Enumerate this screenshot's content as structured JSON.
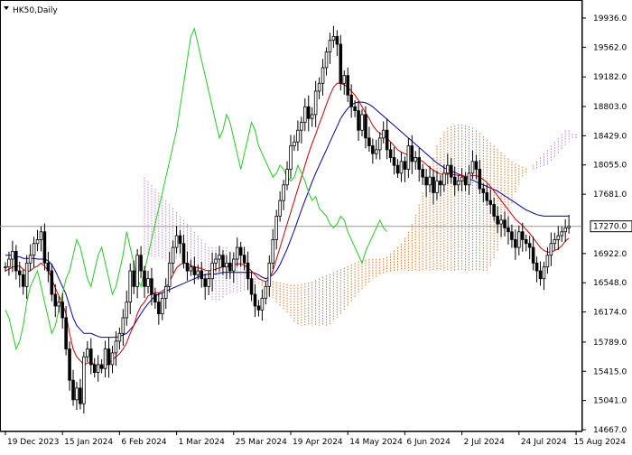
{
  "chart_data": {
    "type": "candlestick",
    "symbol_label": "HK50,Daily",
    "last_price_label": "17270.0",
    "colors": {
      "background": "#ffffff",
      "candle": "#000000",
      "tenkan": "#cc0000",
      "kijun": "#0000aa",
      "chikou": "#22cc22",
      "cloud_bull": "#e07020",
      "cloud_bear": "#c080d0",
      "price_line": "#999999"
    },
    "y_axis": {
      "ylim": [
        14667.0,
        20120.0
      ],
      "ticks": [
        {
          "value": 14667.0,
          "label": "14667.0"
        },
        {
          "value": 15041.0,
          "label": "15041.0"
        },
        {
          "value": 15415.0,
          "label": "15415.0"
        },
        {
          "value": 15789.0,
          "label": "15789.0"
        },
        {
          "value": 16174.0,
          "label": "16174.0"
        },
        {
          "value": 16548.0,
          "label": "16548.0"
        },
        {
          "value": 16922.0,
          "label": "16922.0"
        },
        {
          "value": 17681.0,
          "label": "17681.0"
        },
        {
          "value": 18055.0,
          "label": "18055.0"
        },
        {
          "value": 18429.0,
          "label": "18429.0"
        },
        {
          "value": 18803.0,
          "label": "18803.0"
        },
        {
          "value": 19182.0,
          "label": "19182.0"
        },
        {
          "value": 19562.0,
          "label": "19562.0"
        },
        {
          "value": 19936.0,
          "label": "19936.0"
        }
      ]
    },
    "x_axis": {
      "ticks": [
        {
          "index": 0,
          "label": "19 Dec 2023"
        },
        {
          "index": 16,
          "label": "15 Jan 2024"
        },
        {
          "index": 32,
          "label": "6 Feb 2024"
        },
        {
          "index": 48,
          "label": "1 Mar 2024"
        },
        {
          "index": 64,
          "label": "25 Mar 2024"
        },
        {
          "index": 80,
          "label": "19 Apr 2024"
        },
        {
          "index": 96,
          "label": "14 May 2024"
        },
        {
          "index": 112,
          "label": "6 Jun 2024"
        },
        {
          "index": 128,
          "label": "2 Jul 2024"
        },
        {
          "index": 144,
          "label": "24 Jul 2024"
        },
        {
          "index": 160,
          "label": "15 Aug 2024"
        }
      ]
    },
    "price_close": [
      16750,
      16850,
      16950,
      16700,
      16650,
      16500,
      16800,
      16900,
      17050,
      17100,
      17200,
      16800,
      16700,
      16400,
      16250,
      16300,
      16100,
      15700,
      15300,
      15050,
      15200,
      15000,
      15600,
      15700,
      15500,
      15400,
      15500,
      15450,
      15700,
      15500,
      15650,
      15800,
      15900,
      16100,
      16300,
      16700,
      16500,
      16900,
      16700,
      16500,
      16600,
      16400,
      16300,
      16150,
      16350,
      16500,
      16800,
      17000,
      17150,
      17050,
      16800,
      16700,
      16750,
      16650,
      16700,
      16600,
      16500,
      16600,
      16800,
      16850,
      16900,
      16750,
      16800,
      16700,
      16850,
      17000,
      16900,
      16800,
      16600,
      16400,
      16250,
      16200,
      16350,
      16500,
      16800,
      17100,
      17400,
      17600,
      17800,
      18000,
      18300,
      18350,
      18500,
      18600,
      18800,
      18650,
      18700,
      19000,
      19100,
      19300,
      19500,
      19650,
      19700,
      19600,
      19100,
      19200,
      18950,
      18800,
      18750,
      18500,
      18700,
      18400,
      18300,
      18200,
      18250,
      18400,
      18500,
      18250,
      18150,
      18050,
      17950,
      18100,
      18000,
      18300,
      18100,
      18150,
      18000,
      17900,
      17800,
      17900,
      17700,
      17850,
      17800,
      17950,
      18050,
      17900,
      17800,
      17850,
      17900,
      17800,
      17950,
      18100,
      18000,
      17750,
      17700,
      17600,
      17550,
      17400,
      17300,
      17350,
      17250,
      17200,
      17100,
      17000,
      17200,
      17100,
      17050,
      17000,
      16800,
      16700,
      16600,
      16750,
      16900,
      17050,
      17100,
      17150,
      17200,
      17250,
      17270
    ],
    "tenkan": [
      16700,
      16720,
      16750,
      16760,
      16760,
      16720,
      16690,
      16700,
      16740,
      16760,
      16800,
      16760,
      16700,
      16600,
      16480,
      16380,
      16280,
      16150,
      15900,
      15700,
      15600,
      15550,
      15500,
      15520,
      15530,
      15500,
      15480,
      15450,
      15480,
      15520,
      15560,
      15600,
      15640,
      15700,
      15780,
      15900,
      16000,
      16150,
      16250,
      16300,
      16380,
      16400,
      16420,
      16420,
      16440,
      16480,
      16560,
      16650,
      16740,
      16780,
      16800,
      16790,
      16770,
      16750,
      16740,
      16730,
      16710,
      16700,
      16710,
      16720,
      16740,
      16750,
      16760,
      16760,
      16780,
      16790,
      16790,
      16770,
      16740,
      16700,
      16650,
      16600,
      16580,
      16560,
      16600,
      16700,
      16850,
      17000,
      17150,
      17300,
      17450,
      17600,
      17750,
      17900,
      18050,
      18200,
      18330,
      18450,
      18580,
      18700,
      18830,
      18950,
      19050,
      19100,
      19100,
      19080,
      19050,
      19000,
      18950,
      18880,
      18800,
      18720,
      18650,
      18560,
      18500,
      18460,
      18440,
      18400,
      18350,
      18300,
      18250,
      18220,
      18200,
      18180,
      18160,
      18140,
      18120,
      18100,
      18060,
      18020,
      17990,
      17960,
      17940,
      17930,
      17940,
      17940,
      17930,
      17920,
      17920,
      17910,
      17910,
      17920,
      17920,
      17900,
      17870,
      17830,
      17780,
      17720,
      17660,
      17600,
      17540,
      17480,
      17420,
      17360,
      17320,
      17280,
      17230,
      17180,
      17120,
      17060,
      17000,
      16960,
      16940,
      16940,
      16960,
      16980,
      17020,
      17080,
      17120
    ],
    "kijun": [
      16900,
      16900,
      16900,
      16880,
      16880,
      16860,
      16860,
      16860,
      16860,
      16850,
      16850,
      16850,
      16830,
      16780,
      16700,
      16600,
      16500,
      16400,
      16250,
      16100,
      16000,
      15950,
      15900,
      15900,
      15900,
      15880,
      15860,
      15850,
      15850,
      15850,
      15850,
      15850,
      15860,
      15880,
      15900,
      15950,
      16000,
      16080,
      16150,
      16220,
      16280,
      16330,
      16380,
      16400,
      16420,
      16440,
      16460,
      16480,
      16500,
      16520,
      16540,
      16560,
      16580,
      16600,
      16620,
      16640,
      16650,
      16660,
      16660,
      16660,
      16670,
      16680,
      16680,
      16680,
      16680,
      16680,
      16680,
      16680,
      16680,
      16680,
      16670,
      16650,
      16620,
      16600,
      16620,
      16650,
      16700,
      16780,
      16880,
      16980,
      17100,
      17220,
      17350,
      17480,
      17600,
      17720,
      17840,
      17950,
      18050,
      18150,
      18250,
      18350,
      18450,
      18550,
      18650,
      18720,
      18780,
      18820,
      18850,
      18860,
      18860,
      18850,
      18830,
      18800,
      18760,
      18720,
      18680,
      18640,
      18600,
      18560,
      18520,
      18480,
      18440,
      18400,
      18360,
      18320,
      18280,
      18240,
      18200,
      18160,
      18120,
      18080,
      18050,
      18020,
      18000,
      17980,
      17960,
      17940,
      17920,
      17900,
      17880,
      17860,
      17840,
      17820,
      17800,
      17780,
      17760,
      17740,
      17720,
      17690,
      17660,
      17630,
      17600,
      17570,
      17540,
      17510,
      17480,
      17460,
      17440,
      17420,
      17410,
      17400,
      17400,
      17400,
      17400,
      17400,
      17400,
      17400,
      17400
    ],
    "chikou": [
      16200,
      16100,
      15900,
      15700,
      15800,
      16000,
      16300,
      16500,
      16600,
      16700,
      16500,
      16300,
      16100,
      15900,
      16000,
      16200,
      16400,
      16600,
      16700,
      16900,
      17100,
      17000,
      16800,
      16600,
      16500,
      16700,
      16900,
      17000,
      16800,
      16600,
      16400,
      16500,
      16700,
      16900,
      17200,
      17000,
      16800,
      16600,
      16500,
      16700,
      16900,
      17100,
      17300,
      17500,
      17700,
      17900,
      18100,
      18300,
      18500,
      18800,
      19100,
      19400,
      19700,
      19800,
      19600,
      19400,
      19200,
      19000,
      18800,
      18600,
      18400,
      18500,
      18700,
      18600,
      18400,
      18200,
      18000,
      18200,
      18400,
      18600,
      18500,
      18300,
      18200,
      18100,
      18000,
      17900,
      17950,
      18050,
      18000,
      17900,
      17850,
      17900,
      18050,
      17950,
      17850,
      17700,
      17600,
      17650,
      17500,
      17450,
      17400,
      17300,
      17250,
      17300,
      17400,
      17350,
      17200,
      17100,
      17000,
      16900,
      16800,
      16950,
      17050,
      17150,
      17250,
      17350,
      17250,
      17200
    ],
    "senkou_a": [
      16900,
      16900,
      16880,
      16870,
      16870,
      16850,
      16830,
      16830,
      16840,
      16850,
      16870,
      16860,
      16830,
      16790,
      16740,
      16680,
      16620,
      16540,
      16420,
      16330,
      16300,
      16320,
      16360,
      16380,
      16400,
      16410,
      16420,
      16430,
      16450,
      16470,
      16500,
      16520,
      16540,
      16560,
      16570,
      16580,
      16570,
      16560,
      16550,
      16540,
      16530,
      16520,
      16520,
      16520,
      16530,
      16540,
      16550,
      16560,
      16580,
      16600,
      16620,
      16640,
      16660,
      16680,
      16700,
      16720,
      16740,
      16760,
      16780,
      16800,
      16820,
      16830,
      16840,
      16850,
      16850,
      16850,
      16850,
      16860,
      16880,
      16920,
      16960,
      17000,
      17050,
      17120,
      17200,
      17300,
      17420,
      17550,
      17700,
      17850,
      18000,
      18150,
      18300,
      18400,
      18480,
      18530,
      18550,
      18560,
      18570,
      18570,
      18560,
      18550,
      18530,
      18500,
      18460,
      18420,
      18380,
      18340,
      18300,
      18260,
      18220,
      18180,
      18140,
      18100,
      18070,
      18050,
      18030,
      18010,
      18000,
      18000,
      18000,
      18010,
      18030,
      18060,
      18100,
      18150,
      18200,
      18250,
      18300,
      18350,
      18400,
      18450
    ],
    "senkou_b": [
      17900,
      17850,
      17800,
      17750,
      17700,
      17650,
      17600,
      17550,
      17500,
      17450,
      17400,
      17350,
      17300,
      17250,
      17200,
      17150,
      17100,
      17050,
      17000,
      17000,
      17000,
      17000,
      17000,
      17000,
      16950,
      16900,
      16850,
      16800,
      16750,
      16700,
      16650,
      16600,
      16550,
      16500,
      16450,
      16400,
      16350,
      16300,
      16250,
      16200,
      16150,
      16100,
      16050,
      16000,
      16000,
      16000,
      16000,
      16000,
      16000,
      16000,
      16000,
      16000,
      16000,
      16050,
      16100,
      16150,
      16200,
      16250,
      16300,
      16350,
      16400,
      16450,
      16500,
      16550,
      16600,
      16620,
      16640,
      16660,
      16680,
      16690,
      16700,
      16700,
      16700,
      16700,
      16700,
      16700,
      16700,
      16700,
      16700,
      16700,
      16700,
      16700,
      16700,
      16700,
      16700,
      16700,
      16700,
      16700,
      16700,
      16700,
      16700,
      16700,
      16700,
      16700,
      16700,
      16700,
      16700,
      16750,
      16850,
      16950,
      17100,
      17250,
      17400,
      17550,
      17700,
      17800,
      17900,
      17950,
      18000,
      18050,
      18100,
      18150,
      18200,
      18250,
      18300,
      18350,
      18400,
      18450,
      18500,
      18500,
      18450,
      18400
    ]
  }
}
